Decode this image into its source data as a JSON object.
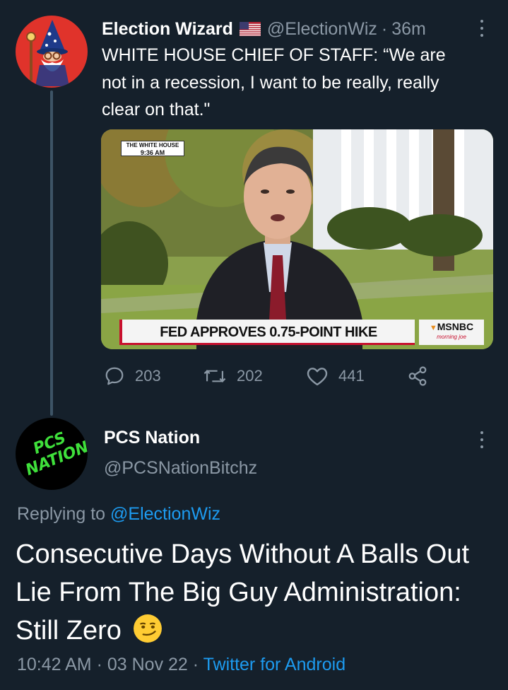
{
  "tweet1": {
    "name": "Election Wizard",
    "flag_icon": "us-flag-icon",
    "handle": "@ElectionWiz",
    "separator": "·",
    "time": "36m",
    "text": "WHITE HOUSE CHIEF OF STAFF: “We are\nnot in a recession, I want to be really, really\nclear on that.\"",
    "media": {
      "bug_title": "THE WHITE HOUSE",
      "bug_time": "9:36 AM",
      "headline": "FED APPROVES 0.75-POINT HIKE",
      "network": "MSNBC",
      "show": "morning joe"
    },
    "actions": {
      "replies": "203",
      "retweets": "202",
      "likes": "441"
    }
  },
  "tweet2": {
    "avatar_text_line1": "PCS",
    "avatar_text_line2": "NATION",
    "name": "PCS Nation",
    "handle": "@PCSNationBitchz",
    "replying_prefix": "Replying to",
    "replying_to": "@ElectionWiz",
    "text": "Consecutive Days Without A Balls Out Lie From The Big Guy Administration: Still Zero",
    "emoji": "smirking-face-emoji",
    "timestamp": "10:42 AM",
    "separator1": "·",
    "date": "03 Nov 22",
    "separator2": "·",
    "source": "Twitter for Android"
  },
  "colors": {
    "background": "#15202b",
    "secondary_text": "#8b98a5",
    "link": "#1d9bf0",
    "avatar1_bg": "#e0332b",
    "avatar2_text": "#3fe03b"
  }
}
